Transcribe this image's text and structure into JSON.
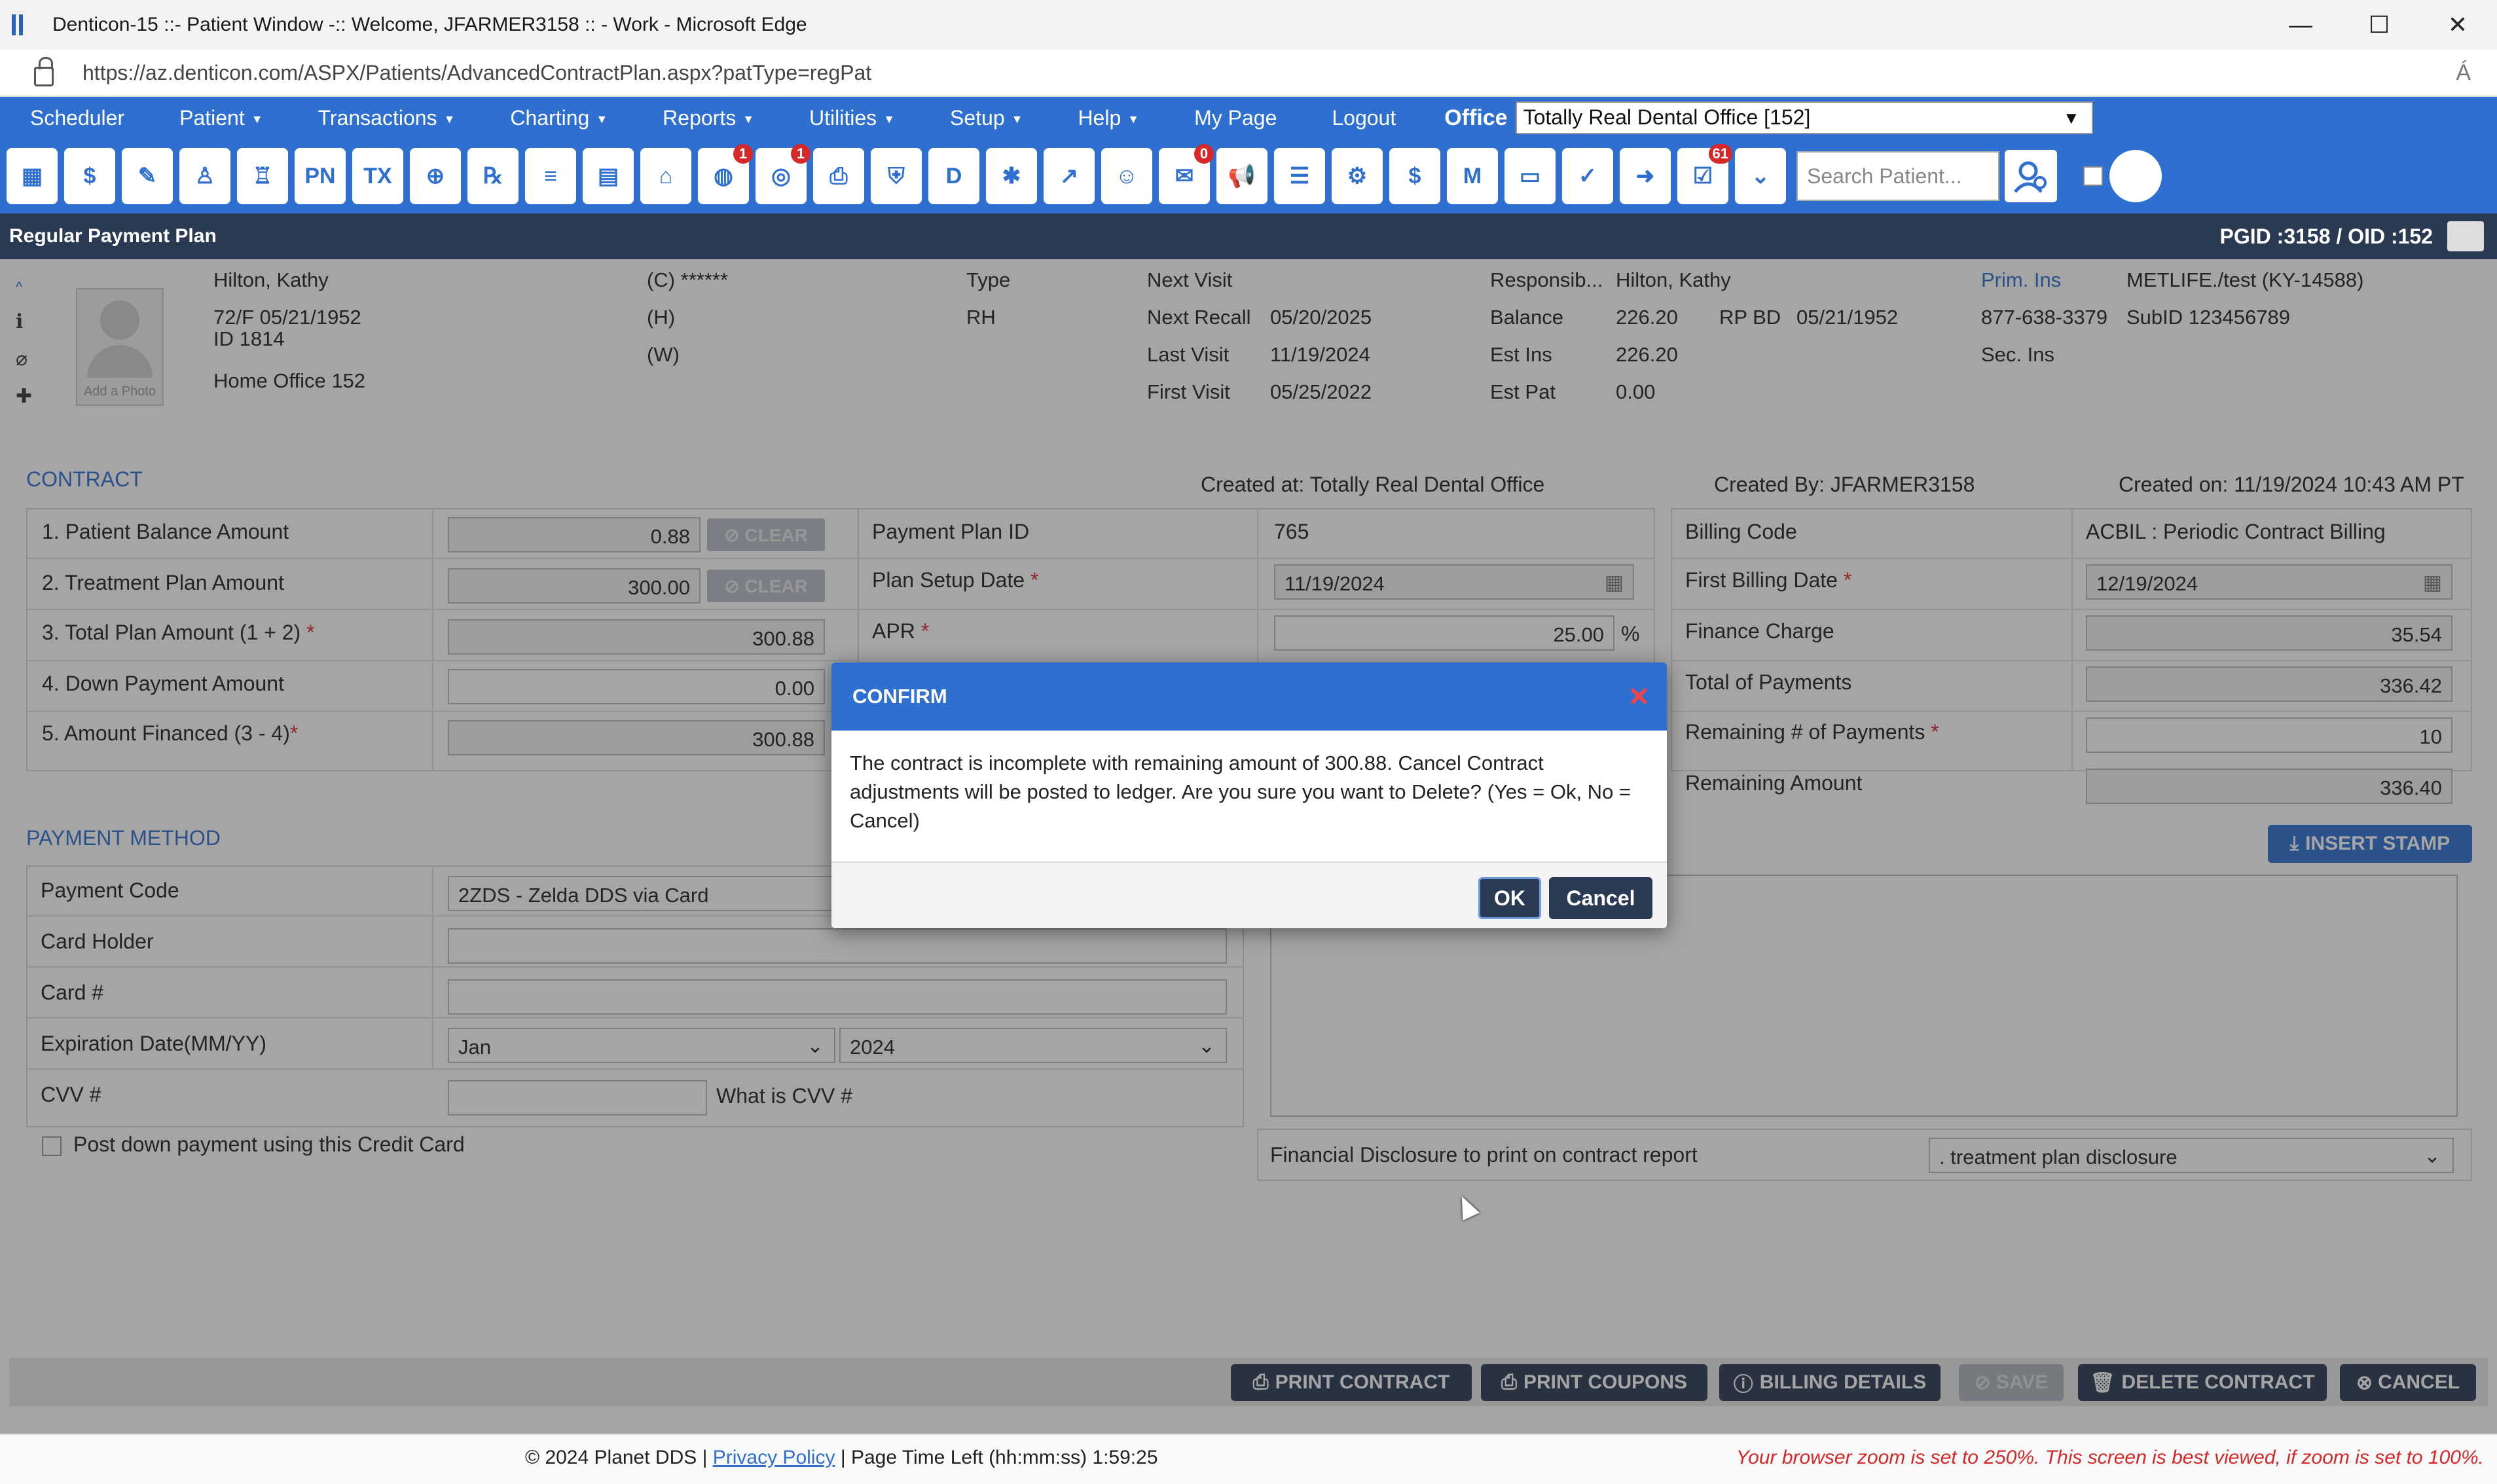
{
  "window": {
    "title": "Denticon-15 ::- Patient Window -:: Welcome, JFARMER3158 :: - Work - Microsoft Edge",
    "url": "https://az.denticon.com/ASPX/Patients/AdvancedContractPlan.aspx?patType=regPat",
    "minimize": "—",
    "maximize": "☐",
    "close": "✕",
    "read_aloud": "Á"
  },
  "nav": {
    "items": [
      {
        "label": "Scheduler",
        "caret": false
      },
      {
        "label": "Patient",
        "caret": true
      },
      {
        "label": "Transactions",
        "caret": true
      },
      {
        "label": "Charting",
        "caret": true
      },
      {
        "label": "Reports",
        "caret": true
      },
      {
        "label": "Utilities",
        "caret": true
      },
      {
        "label": "Setup",
        "caret": true
      },
      {
        "label": "Help",
        "caret": true
      },
      {
        "label": "My Page",
        "caret": false
      },
      {
        "label": "Logout",
        "caret": false
      }
    ],
    "office_label": "Office",
    "office_value": "Totally Real Dental Office [152]"
  },
  "toolbar": {
    "icons": [
      {
        "name": "calendar-icon",
        "glyph": "▦"
      },
      {
        "name": "dollar-icon",
        "glyph": "$"
      },
      {
        "name": "edit-icon",
        "glyph": "✎"
      },
      {
        "name": "tooth-icon",
        "glyph": "♙"
      },
      {
        "name": "tooth-chart-icon",
        "glyph": "♖"
      },
      {
        "name": "pn-icon",
        "glyph": "PN"
      },
      {
        "name": "tx-icon",
        "glyph": "TX"
      },
      {
        "name": "add-patient-icon",
        "glyph": "⊕"
      },
      {
        "name": "rx-icon",
        "glyph": "℞"
      },
      {
        "name": "notes-icon",
        "glyph": "≡"
      },
      {
        "name": "document-icon",
        "glyph": "▤"
      },
      {
        "name": "home-icon",
        "glyph": "⌂"
      },
      {
        "name": "web-icon",
        "glyph": "◍",
        "badge": "1"
      },
      {
        "name": "recall-icon",
        "glyph": "◎",
        "badge": "1"
      },
      {
        "name": "print-icon",
        "glyph": "⎙"
      },
      {
        "name": "insurance-icon",
        "glyph": "⛨"
      },
      {
        "name": "ledger-icon",
        "glyph": "D"
      },
      {
        "name": "network-icon",
        "glyph": "✱"
      },
      {
        "name": "chart-icon",
        "glyph": "↗"
      },
      {
        "name": "user-circle-icon",
        "glyph": "☺"
      },
      {
        "name": "message-icon",
        "glyph": "✉",
        "badge": "0"
      },
      {
        "name": "megaphone-icon",
        "glyph": "📢"
      },
      {
        "name": "claims-icon",
        "glyph": "☰"
      },
      {
        "name": "settings-ledger-icon",
        "glyph": "⚙"
      },
      {
        "name": "shield-dollar-icon",
        "glyph": "$"
      },
      {
        "name": "mail-icon",
        "glyph": "M"
      },
      {
        "name": "id-card-icon",
        "glyph": "▭"
      },
      {
        "name": "check-shield-icon",
        "glyph": "✓"
      },
      {
        "name": "arrow-shield-icon",
        "glyph": "➜"
      },
      {
        "name": "tasks-icon",
        "glyph": "☑",
        "badge": "61"
      },
      {
        "name": "double-chevron-icon",
        "glyph": "⌄"
      }
    ],
    "search_placeholder": "Search Patient..."
  },
  "page": {
    "title": "Regular Payment Plan",
    "ids": "PGID :3158  /  OID :152"
  },
  "patient": {
    "name": "Hilton, Kathy",
    "age_sex_dob": "72/F   05/21/1952",
    "id": "ID 1814",
    "home_office": "Home Office   152",
    "add_photo": "Add a Photo",
    "phone_c": "(C) ******",
    "phone_h": "(H)",
    "phone_w": "(W)",
    "type_label": "Type",
    "type_value": "RH",
    "next_visit_label": "Next Visit",
    "next_recall_label": "Next Recall",
    "next_recall_value": "05/20/2025",
    "last_visit_label": "Last Visit",
    "last_visit_value": "11/19/2024",
    "first_visit_label": "First Visit",
    "first_visit_value": "05/25/2022",
    "responsible_label": "Responsib...",
    "responsible_value": "Hilton, Kathy",
    "balance_label": "Balance",
    "balance_value": "226.20",
    "rpbd_label": "RP BD",
    "rpbd_value": "05/21/1952",
    "est_ins_label": "Est Ins",
    "est_ins_value": "226.20",
    "est_pat_label": "Est Pat",
    "est_pat_value": "0.00",
    "prim_ins_label": "Prim. Ins",
    "prim_ins_value": "METLIFE./test (KY-14588)",
    "ins_phone": "877-638-3379",
    "subid": "SubID  123456789",
    "sec_ins_label": "Sec. Ins"
  },
  "contract": {
    "section_title": "CONTRACT",
    "created_at": "Created at: Totally Real Dental Office",
    "created_by": "Created By: JFARMER3158",
    "created_on": "Created on: 11/19/2024 10:43 AM PT",
    "rows": [
      {
        "label": "1.  Patient Balance Amount",
        "value": "0.88",
        "clear": "⊘ CLEAR"
      },
      {
        "label": "2. Treatment Plan Amount",
        "value": "300.00",
        "clear": "⊘ CLEAR"
      },
      {
        "label": "3. Total Plan Amount (1 + 2)",
        "value": "300.88"
      },
      {
        "label": "4. Down Payment Amount",
        "value": "0.00"
      },
      {
        "label": "5. Amount Financed (3 - 4)",
        "value": "300.88"
      }
    ],
    "plan_id_label": "Payment Plan ID",
    "plan_id_value": "765",
    "setup_date_label": "Plan Setup Date",
    "setup_date_value": "11/19/2024",
    "apr_label": "APR",
    "apr_value": "25.00",
    "apr_unit": "%",
    "billing_code_label": "Billing Code",
    "billing_code_value": "ACBIL : Periodic Contract Billing",
    "first_billing_label": "First Billing Date",
    "first_billing_value": "12/19/2024",
    "finance_charge_label": "Finance Charge",
    "finance_charge_value": "35.54",
    "total_payments_label": "Total of Payments",
    "total_payments_value": "336.42",
    "remaining_count_label": "Remaining # of Payments",
    "remaining_count_value": "10",
    "remaining_amount_label": "Remaining Amount",
    "remaining_amount_value": "336.40",
    "required_mark": "*"
  },
  "payment_method": {
    "section_title": "PAYMENT METHOD",
    "payment_code_label": "Payment Code",
    "payment_code_value": "2ZDS - Zelda DDS via Card",
    "card_holder_label": "Card Holder",
    "card_number_label": "Card #",
    "expiration_label": "Expiration Date(MM/YY)",
    "exp_month": "Jan",
    "exp_year": "2024",
    "cvv_label": "CVV #",
    "what_is_cvv": "What is CVV #",
    "post_down_payment_label": "Post down payment using this Credit Card"
  },
  "notes": {
    "insert_stamp": "INSERT STAMP",
    "disclosure_label": "Financial Disclosure to print on contract report",
    "disclosure_value": ". treatment plan disclosure"
  },
  "footer_buttons": {
    "print_contract": "PRINT CONTRACT",
    "print_coupons": "PRINT COUPONS",
    "billing_details": "BILLING DETAILS",
    "save": "SAVE",
    "delete_contract": "DELETE CONTRACT",
    "cancel": "CANCEL"
  },
  "bottom": {
    "copyright": "© 2024 Planet DDS",
    "privacy": "Privacy Policy",
    "separator": "|",
    "time_left": "Page Time Left (hh:mm:ss) 1:59:25",
    "zoom_warning": "Your browser zoom is set to 250%. This screen is best viewed, if zoom is set to 100%."
  },
  "dialog": {
    "title": "CONFIRM",
    "message": "The contract is incomplete with remaining amount of 300.88. Cancel Contract adjustments will be posted to ledger. Are you sure you want to Delete? (Yes = Ok, No = Cancel)",
    "ok": "OK",
    "cancel": "Cancel",
    "close_glyph": "✕"
  }
}
